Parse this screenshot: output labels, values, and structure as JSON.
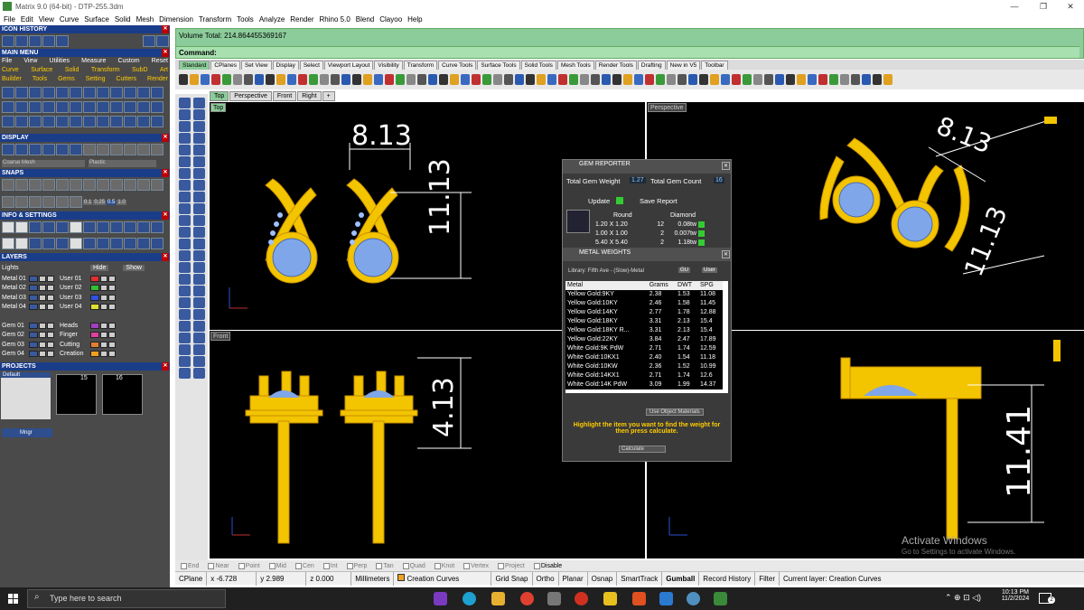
{
  "window": {
    "title": "Matrix 9.0 (64-bit) - DTP-255.3dm",
    "controls": [
      "—",
      "❐",
      "✕"
    ]
  },
  "menubar": [
    "File",
    "Edit",
    "View",
    "Curve",
    "Surface",
    "Solid",
    "Mesh",
    "Dimension",
    "Transform",
    "Tools",
    "Analyze",
    "Render",
    "Rhino 5.0",
    "Blend",
    "Clayoo",
    "Help"
  ],
  "leftpanel": {
    "icon_history": "ICON HISTORY",
    "main_menu": "MAIN MENU",
    "main_menu_row1": [
      "File",
      "View",
      "Utilities",
      "Measure",
      "Custom",
      "Reset"
    ],
    "main_menu_row2": [
      "Curve",
      "Surface",
      "Solid",
      "Transform",
      "SubD",
      "Art"
    ],
    "main_menu_row3": [
      "Builder",
      "Tools",
      "Gems",
      "Setting",
      "Cutters",
      "Render"
    ],
    "display": "DISPLAY",
    "display_mode": "Coarse Mesh",
    "display_material": "Plastic",
    "snaps": "SNAPS",
    "snap_values": [
      "0.1",
      "0.25",
      "0.5",
      "1.0"
    ],
    "info_settings": "INFO & SETTINGS",
    "layers": "LAYERS",
    "layers_lights": "Lights",
    "layers_hide": "Hide",
    "layers_show": "Show",
    "layer_rows": [
      {
        "left": "Metal 01",
        "right": "User 01",
        "color": "#e03030"
      },
      {
        "left": "Metal 02",
        "right": "User 02",
        "color": "#30c030"
      },
      {
        "left": "Metal 03",
        "right": "User 03",
        "color": "#3050e0"
      },
      {
        "left": "Metal 04",
        "right": "User 04",
        "color": "#e0e030"
      },
      {
        "left": "",
        "right": "",
        "color": "#000000"
      },
      {
        "left": "Gem 01",
        "right": "Heads",
        "color": "#a040c0"
      },
      {
        "left": "Gem 02",
        "right": "Finger",
        "color": "#e040a0"
      },
      {
        "left": "Gem 03",
        "right": "Cutting",
        "color": "#e08030"
      },
      {
        "left": "Gem 04",
        "right": "Creation",
        "color": "#f0a020"
      }
    ],
    "projects": "PROJECTS",
    "project_name": "Default",
    "project_nums": [
      "15",
      "16"
    ],
    "mngr": "Mngr"
  },
  "command": {
    "volume_label": "Volume Total: 214.864455369167",
    "prompt": "Command:"
  },
  "toolbar_tabs": [
    "Standard",
    "CPlanes",
    "Set View",
    "Display",
    "Select",
    "Viewport Layout",
    "Visibility",
    "Transform",
    "Curve Tools",
    "Surface Tools",
    "Solid Tools",
    "Mesh Tools",
    "Render Tools",
    "Drafting",
    "New in V5",
    "Toolbar"
  ],
  "viewport_tabs": [
    "Top",
    "Perspective",
    "Front",
    "Right",
    "+"
  ],
  "viewports": {
    "top_label": "Top",
    "persp_label": "Perspective",
    "front_label": "Front",
    "dims": {
      "top_width": "8.13",
      "top_height": "11.13",
      "front_height": "4.13",
      "persp_width": "8.13",
      "persp_height": "11.13",
      "right_height": "11.41"
    }
  },
  "gem_reporter": {
    "title": "GEM REPORTER",
    "total_weight_label": "Total Gem Weight",
    "total_weight": "1.27",
    "total_count_label": "Total Gem Count",
    "total_count": "16",
    "update": "Update",
    "save_report": "Save Report",
    "col_shape": "Round",
    "col_type": "Diamond",
    "rows": [
      {
        "size": "1.20 X 1.20",
        "count": "12",
        "weight": "0.08tw"
      },
      {
        "size": "1.00 X 1.00",
        "count": "2",
        "weight": "0.007tw"
      },
      {
        "size": "5.40 X 5.40",
        "count": "2",
        "weight": "1.18tw"
      }
    ]
  },
  "metal_weights": {
    "title": "METAL WEIGHTS",
    "library": "Library: Fifth Ave - (Slow)-Metal",
    "btn_gu": "GU",
    "btn_user": "User",
    "headers": [
      "Metal",
      "Grams",
      "DWT",
      "SPG"
    ],
    "rows": [
      [
        "Yellow Gold:9KY",
        "2.38",
        "1.53",
        "11.08"
      ],
      [
        "Yellow Gold:10KY",
        "2.46",
        "1.58",
        "11.45"
      ],
      [
        "Yellow Gold:14KY",
        "2.77",
        "1.78",
        "12.88"
      ],
      [
        "Yellow Gold:18KY",
        "3.31",
        "2.13",
        "15.4"
      ],
      [
        "Yellow Gold:18KY R...",
        "3.31",
        "2.13",
        "15.4"
      ],
      [
        "Yellow Gold:22KY",
        "3.84",
        "2.47",
        "17.89"
      ],
      [
        "White Gold:9K PdW",
        "2.71",
        "1.74",
        "12.59"
      ],
      [
        "White Gold:10KX1",
        "2.40",
        "1.54",
        "11.18"
      ],
      [
        "White Gold:10KW",
        "2.36",
        "1.52",
        "10.99"
      ],
      [
        "White Gold:14KX1",
        "2.71",
        "1.74",
        "12.6"
      ],
      [
        "White Gold:14K PdW",
        "3.09",
        "1.99",
        "14.37"
      ]
    ],
    "use_object": "Use Object Materials",
    "hint": "Highlight the item you want to find the weight for then press calculate.",
    "calculate": "Calculate"
  },
  "osnap": [
    "End",
    "Near",
    "Point",
    "Mid",
    "Cen",
    "Int",
    "Perp",
    "Tan",
    "Quad",
    "Knot",
    "Vertex",
    "Project",
    "Disable"
  ],
  "status": {
    "cplane": "CPlane",
    "x": "x -6.728",
    "y": "y 2.989",
    "z": "z 0.000",
    "units": "Millimeters",
    "layer": "Creation Curves",
    "grid": "Grid Snap",
    "ortho": "Ortho",
    "planar": "Planar",
    "osnap": "Osnap",
    "smarttrack": "SmartTrack",
    "gumball": "Gumball",
    "history": "Record History",
    "filter": "Filter",
    "current_layer": "Current layer: Creation Curves"
  },
  "activate": {
    "line1": "Activate Windows",
    "line2": "Go to Settings to activate Windows."
  },
  "taskbar": {
    "search": "Type here to search",
    "time": "10:13 PM",
    "date": "11/2/2024",
    "badge": "2"
  }
}
